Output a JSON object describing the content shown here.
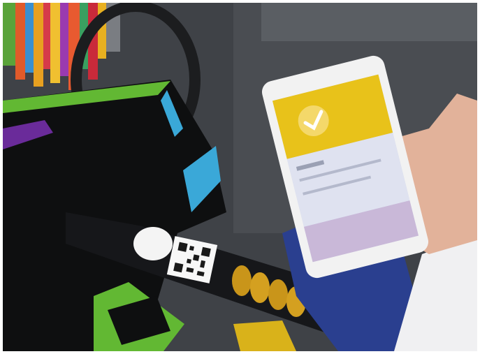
{
  "photo": {
    "frame_color": "#ffffff",
    "palette": {
      "pavement": "#3f4247",
      "umbrella_canopy": "#0e0f10",
      "umbrella_green": "#62b833",
      "umbrella_blue": "#3aa8d8",
      "umbrella_purple": "#6a2b9a",
      "lock_gold": "#c9951a",
      "phone_white": "#f2f2f2",
      "app_yellow": "#e8c21a",
      "skin": "#e2b29a",
      "sleeve_blue": "#2a3f8f"
    },
    "icons": {
      "check": "check-icon",
      "qr": "qr-code-icon"
    }
  }
}
